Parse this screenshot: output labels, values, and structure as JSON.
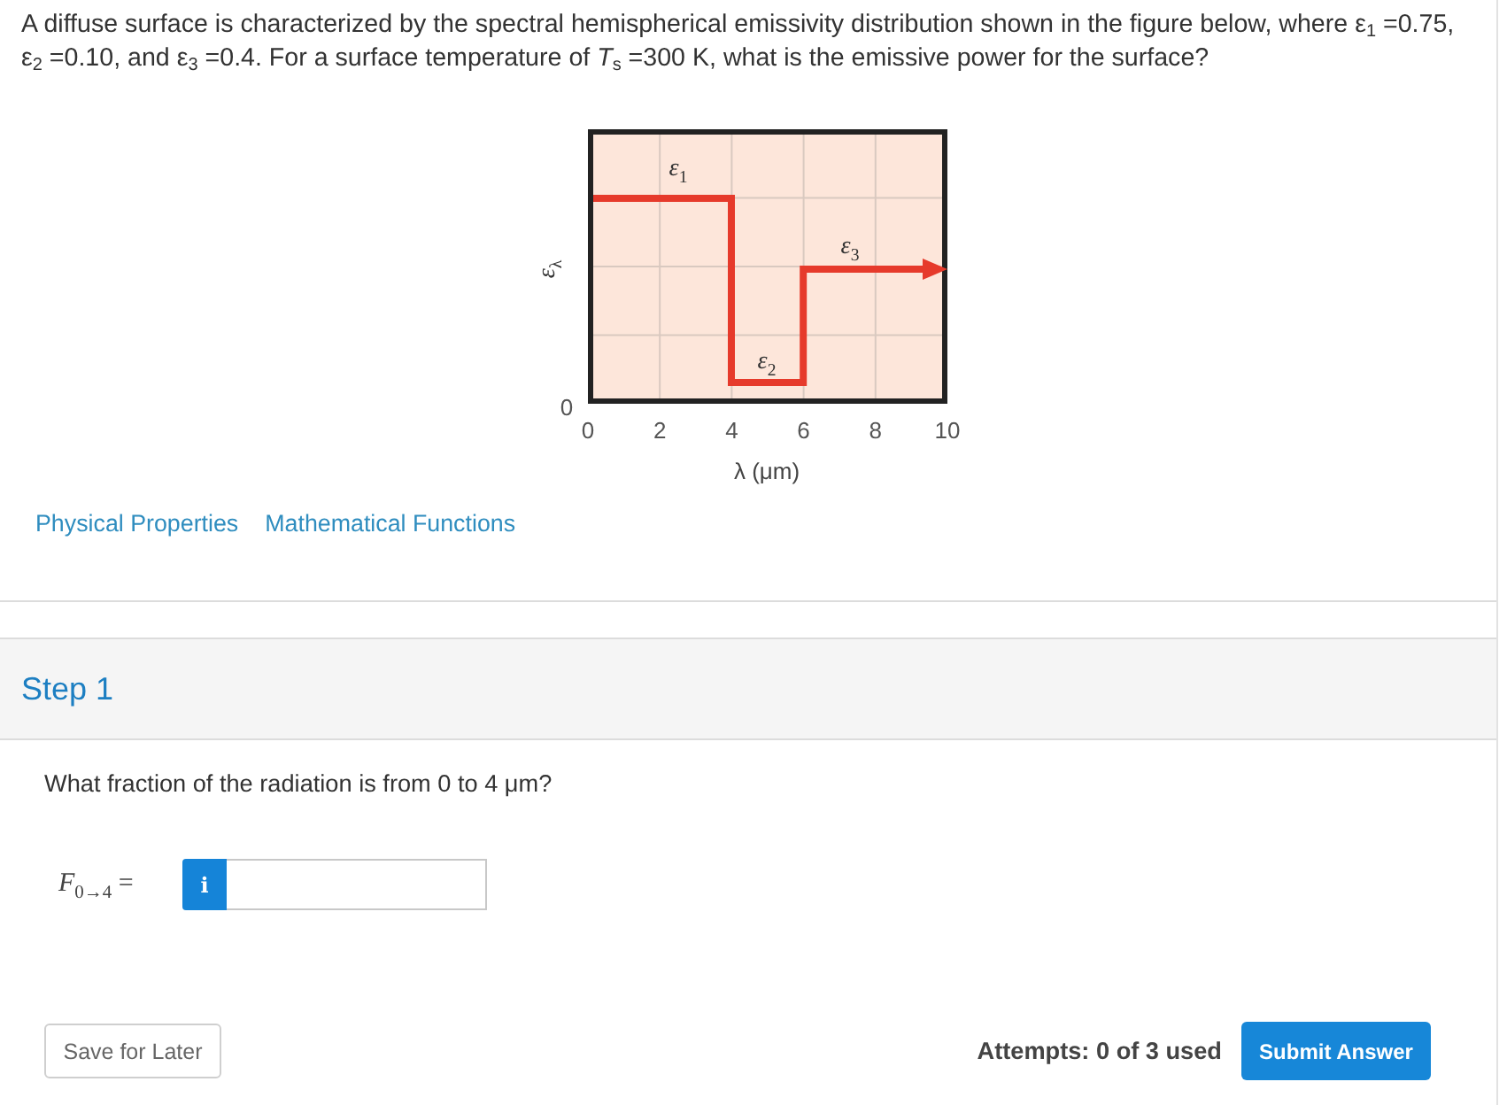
{
  "problem": {
    "text": "A diffuse surface is characterized by the spectral hemispherical emissivity distribution shown in the figure below, where ε$_{1}$ =0.75, ε$_{2}$ =0.10, and ε$_{3}$ =0.4. For a surface temperature of *T*$_{s}$ =300 K, what is the emissive power for the surface?"
  },
  "figure": {
    "ylabel": "ε$_{λ}$",
    "y_tick": "0",
    "x_ticks": [
      "0",
      "2",
      "4",
      "6",
      "8",
      "10"
    ],
    "xlabel": "λ (μm)",
    "curve_labels": [
      "ε$_{1}$",
      "ε$_{2}$",
      "ε$_{3}$"
    ]
  },
  "links": [
    "Physical Properties",
    "Mathematical Functions"
  ],
  "step": {
    "title": "Step 1",
    "question": "What fraction of the radiation is from 0 to 4 μm?",
    "answer": {
      "label": "*F*$_{0→4}$ =",
      "info_button": "i"
    }
  },
  "footer": {
    "save_button": "Save for Later",
    "attempts": "Attempts: 0 of 3 used",
    "submit_button": "Submit Answer"
  }
}
